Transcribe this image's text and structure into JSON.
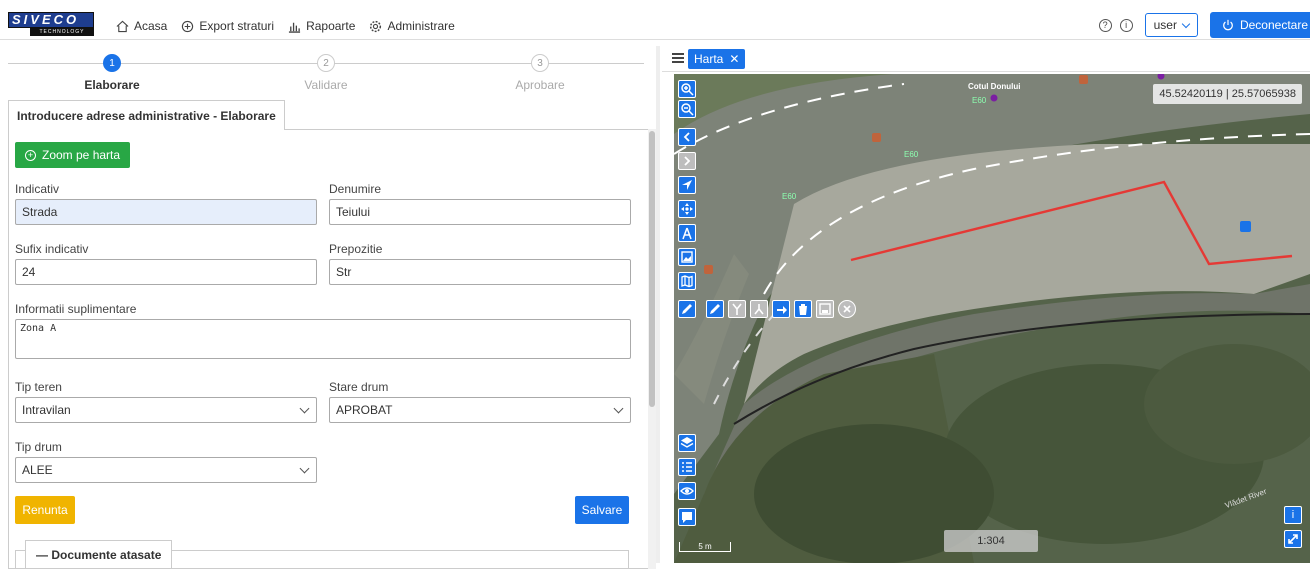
{
  "nav": {
    "logo_text": "SIVECO",
    "logo_sub": "TECHNOLOGY",
    "links": [
      {
        "label": "Acasa"
      },
      {
        "label": "Export straturi"
      },
      {
        "label": "Rapoarte"
      },
      {
        "label": "Administrare"
      }
    ],
    "help_glyph": "?",
    "info_glyph": "i",
    "user_label": "user",
    "logout_label": "Deconectare"
  },
  "steps": [
    {
      "num": "1",
      "label": "Elaborare",
      "active": true
    },
    {
      "num": "2",
      "label": "Validare",
      "active": false
    },
    {
      "num": "3",
      "label": "Aprobare",
      "active": false
    }
  ],
  "form": {
    "section_title": "Introducere adrese administrative - Elaborare",
    "zoom_label": "Zoom pe harta",
    "indicativ_label": "Indicativ",
    "indicativ_value": "Strada",
    "denumire_label": "Denumire",
    "denumire_value": "Teiului",
    "sufix_label": "Sufix indicativ",
    "sufix_value": "24",
    "prepozitie_label": "Prepozitie",
    "prepozitie_value": "Str",
    "info_label": "Informatii suplimentare",
    "info_value": "Zona A",
    "tip_teren_label": "Tip teren",
    "tip_teren_value": "Intravilan",
    "stare_drum_label": "Stare drum",
    "stare_drum_value": "APROBAT",
    "tip_drum_label": "Tip drum",
    "tip_drum_value": "ALEE",
    "cancel_label": "Renunta",
    "save_label": "Salvare",
    "docs_title": "Documente atasate",
    "docs_glyph": "—"
  },
  "map": {
    "tab_label": "Harta",
    "tab_close": "✕",
    "coords": "45.52420119 | 25.57065938",
    "scale_ratio": "1:304",
    "scale_bar": "5 m",
    "place_label": "Cotul Donului",
    "road_label_1": "E60",
    "road_label_2": "E60",
    "road_label_3": "E60",
    "river_label": "Vlădet River",
    "info_glyph": "i",
    "colors": {
      "accent": "#1a73e8",
      "line": "#e53935",
      "success": "#28a745",
      "warning": "#f0b400"
    }
  }
}
